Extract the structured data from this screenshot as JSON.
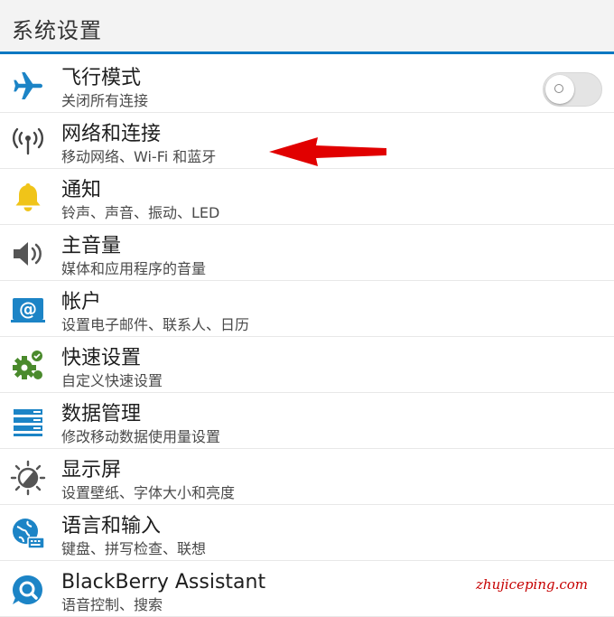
{
  "header": {
    "title": "系统设置"
  },
  "colors": {
    "accent": "#0a78c2",
    "arrow": "#e10000",
    "icon_blue": "#1c84c6",
    "bell_yellow": "#f0c419",
    "gear_green": "#4a8a2c"
  },
  "settings": [
    {
      "title": "飞行模式",
      "subtitle": "关闭所有连接",
      "icon": "airplane-icon",
      "toggle": {
        "state": "off"
      }
    },
    {
      "title": "网络和连接",
      "subtitle": "移动网络、Wi-Fi 和蓝牙",
      "icon": "antenna-icon"
    },
    {
      "title": "通知",
      "subtitle": "铃声、声音、振动、LED",
      "icon": "bell-icon"
    },
    {
      "title": "主音量",
      "subtitle": "媒体和应用程序的音量",
      "icon": "speaker-icon"
    },
    {
      "title": "帐户",
      "subtitle": "设置电子邮件、联系人、日历",
      "icon": "at-sign-icon"
    },
    {
      "title": "快速设置",
      "subtitle": "自定义快速设置",
      "icon": "quick-settings-gear-icon"
    },
    {
      "title": "数据管理",
      "subtitle": "修改移动数据使用量设置",
      "icon": "data-bars-icon"
    },
    {
      "title": "显示屏",
      "subtitle": "设置壁纸、字体大小和亮度",
      "icon": "brightness-icon"
    },
    {
      "title": "语言和输入",
      "subtitle": "键盘、拼写检查、联想",
      "icon": "globe-keyboard-icon"
    },
    {
      "title": "BlackBerry Assistant",
      "subtitle": "语音控制、搜索",
      "icon": "assistant-icon"
    }
  ],
  "watermark": "zhujiceping.com"
}
